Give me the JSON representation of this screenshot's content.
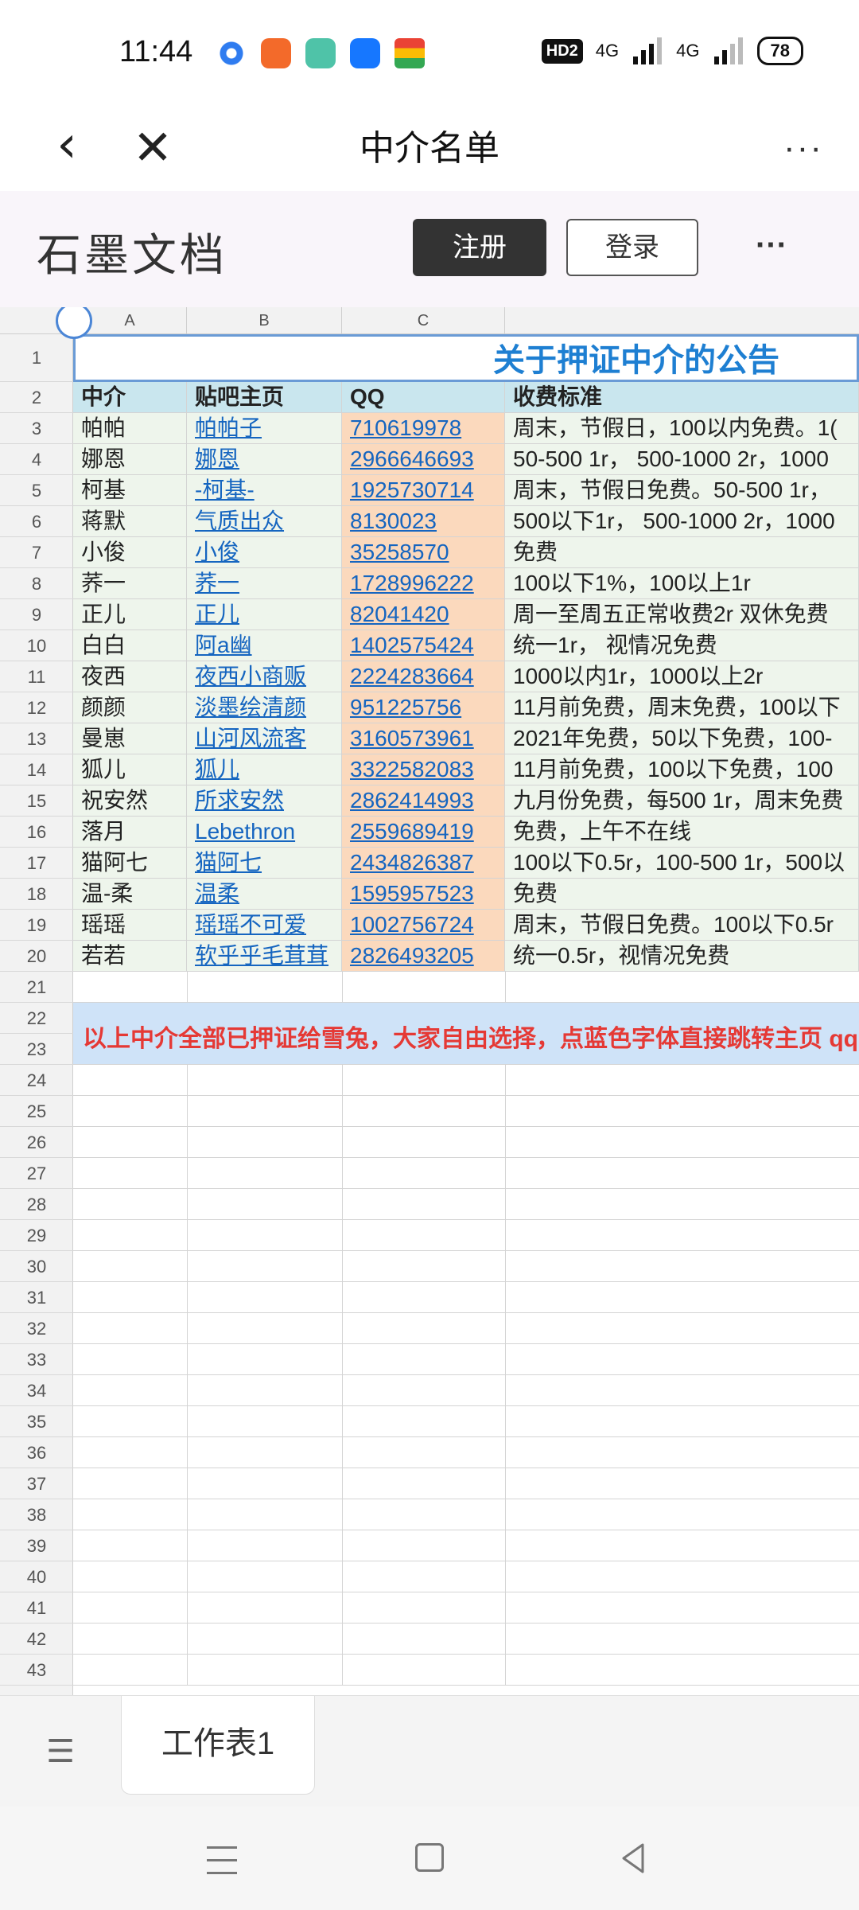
{
  "status_bar": {
    "time": "11:44",
    "network_badge": "HD2",
    "signal_1": "4G",
    "signal_2": "4G",
    "battery": "78"
  },
  "title_bar": {
    "back_icon": "‹",
    "close_icon": "✕",
    "title": "中介名单",
    "more_icon": "···"
  },
  "app_header": {
    "logo": "石墨文档",
    "register_label": "注册",
    "login_label": "登录",
    "more_icon": "···"
  },
  "sheet": {
    "columns": [
      "A",
      "B",
      "C"
    ],
    "row_numbers": [
      "1",
      "2",
      "3",
      "4",
      "5",
      "6",
      "7",
      "8",
      "9",
      "10",
      "11",
      "12",
      "13",
      "14",
      "15",
      "16",
      "17",
      "18",
      "19",
      "20",
      "21",
      "22",
      "23",
      "24",
      "25",
      "26",
      "27",
      "28",
      "29",
      "30",
      "31",
      "32",
      "33",
      "34",
      "35",
      "36",
      "37",
      "38",
      "39",
      "40",
      "41",
      "42",
      "43"
    ],
    "title": "关于押证中介的公告",
    "headers": [
      "中介",
      "贴吧主页",
      "QQ",
      "收费标准"
    ],
    "rows": [
      [
        "帕帕",
        "帕帕子",
        "710619978",
        "周末，节假日，100以内免费。1("
      ],
      [
        "娜恩",
        "娜恩",
        "2966646693",
        "50-500 1r，  500-1000 2r，1000"
      ],
      [
        "柯基",
        "-柯基-",
        "1925730714",
        "周末，节假日免费。50-500 1r，"
      ],
      [
        "蒋默",
        "气质出众",
        "8130023",
        "500以下1r，  500-1000 2r，1000"
      ],
      [
        "小俊",
        "小俊",
        "35258570",
        "免费"
      ],
      [
        "荞一",
        "荞一",
        "1728996222",
        "100以下1%，100以上1r"
      ],
      [
        "正儿",
        "正儿",
        "82041420",
        "周一至周五正常收费2r 双休免费"
      ],
      [
        "白白",
        "阿a幽",
        "1402575424",
        "统一1r，  视情况免费"
      ],
      [
        "夜西",
        "夜西小商贩",
        "2224283664",
        "1000以内1r，1000以上2r"
      ],
      [
        "颜颜",
        "淡墨绘清颜",
        "951225756",
        "11月前免费，周末免费，100以下"
      ],
      [
        "曼崽",
        "山河风流客",
        "3160573961",
        "2021年免费，50以下免费，100-"
      ],
      [
        "狐儿",
        "狐儿",
        "3322582083",
        "11月前免费，100以下免费，100"
      ],
      [
        "祝安然",
        "所求安然",
        "2862414993",
        "九月份免费，每500 1r，周末免费"
      ],
      [
        "落月",
        "Lebethron",
        "2559689419",
        "免费，上午不在线"
      ],
      [
        "猫阿七",
        "猫阿七",
        "2434826387",
        "100以下0.5r，100-500 1r，500以"
      ],
      [
        "温-柔",
        "温柔",
        "1595957523",
        "免费"
      ],
      [
        "瑶瑶",
        "瑶瑶不可爱",
        "1002756724",
        "周末，节假日免费。100以下0.5r"
      ],
      [
        "若若",
        "软乎乎毛茸茸",
        "2826493205",
        "统一0.5r，视情况免费"
      ]
    ],
    "notice": "以上中介全部已押证给雪兔，大家自由选择，点蓝色字体直接跳转主页 qq"
  },
  "tab_bar": {
    "list_icon": "☰",
    "sheet_tab": "工作表1"
  },
  "nav_bar": {
    "menu_icon": "menu",
    "home_icon": "home",
    "back_icon": "back"
  },
  "colors": {
    "name_bg": "#eef5ec",
    "qq_bg": "#fbd9bd",
    "header_bg": "#c9e6ee",
    "link": "#1565c0",
    "title": "#1e7fd2",
    "notice_bg": "#cfe3f8",
    "notice_text": "#e53935"
  }
}
